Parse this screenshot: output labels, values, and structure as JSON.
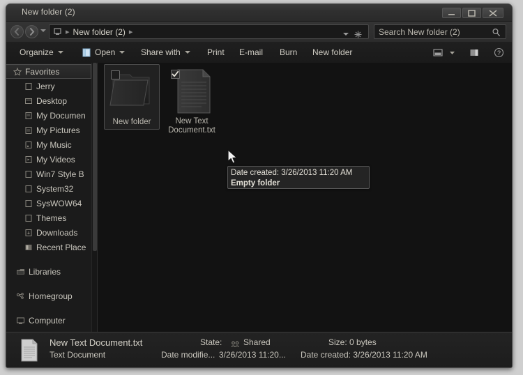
{
  "window": {
    "title": "New folder (2)",
    "controls": {
      "minimize": "Minimize",
      "maximize": "Maximize",
      "close": "Close"
    }
  },
  "addressbar": {
    "crumb": "New folder (2)",
    "sep1": "▸",
    "sep2": "▸",
    "back_label": "Back",
    "forward_label": "Forward"
  },
  "search": {
    "placeholder": "Search New folder (2)"
  },
  "toolbar": {
    "organize": "Organize",
    "open": "Open",
    "share_with": "Share with",
    "print": "Print",
    "email": "E-mail",
    "burn": "Burn",
    "new_folder": "New folder",
    "help": "Help",
    "preview_pane": "Preview pane",
    "change_view": "Change your view"
  },
  "navpane": {
    "favorites": "Favorites",
    "favorites_items": [
      "Jerry",
      "Desktop",
      "My Documen",
      "My Pictures",
      "My Music",
      "My Videos",
      "Win7 Style B",
      "System32",
      "SysWOW64",
      "Themes",
      "Downloads",
      "Recent Place"
    ],
    "libraries": "Libraries",
    "homegroup": "Homegroup",
    "computer": "Computer"
  },
  "files": [
    {
      "name": "New folder",
      "type": "folder",
      "checked": false,
      "hovered": true
    },
    {
      "name": "New Text Document.txt",
      "type": "text",
      "checked": true,
      "hovered": false
    }
  ],
  "tooltip": {
    "line1": "Date created: 3/26/2013 11:20 AM",
    "line2": "Empty folder"
  },
  "details": {
    "name": "New Text Document.txt",
    "type": "Text Document",
    "state_label": "State:",
    "state_value": "Shared",
    "size": "Size: 0 bytes",
    "modified_label": "Date modifie...",
    "modified_value": "3/26/2013 11:20...",
    "created": "Date created: 3/26/2013 11:20 AM"
  },
  "colors": {
    "window_bg": "#2b2b2b",
    "content_bg": "#121212",
    "navpane_bg": "#1b1b1b",
    "text": "#c9c6bd",
    "accent": "#4a4a4a"
  }
}
